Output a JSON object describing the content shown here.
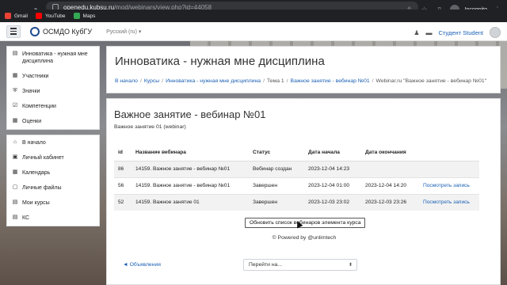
{
  "browser": {
    "url_host": "openedu.kubsu.ru",
    "url_path": "/mod/webinars/view.php?id=44058",
    "incognito_label": "Incognito",
    "bookmarks": [
      {
        "label": "Gmail",
        "color": "#ea4335"
      },
      {
        "label": "YouTube",
        "color": "#ff0000"
      },
      {
        "label": "Maps",
        "color": "#34a853"
      }
    ]
  },
  "navbar": {
    "brand": "ОСМДО КубГУ",
    "language": "Русский (ru) ▾",
    "user_name": "Студент Student"
  },
  "drawer": {
    "groups": [
      [
        {
          "label": "Инноватика - нужная мне дисциплина",
          "icon": "graduation-icon",
          "glyph": "▤"
        },
        {
          "label": "Участники",
          "icon": "users-icon",
          "glyph": "👥"
        },
        {
          "label": "Значки",
          "icon": "shield-icon",
          "glyph": "⛨"
        },
        {
          "label": "Компетенции",
          "icon": "checkbox-icon",
          "glyph": "☑"
        },
        {
          "label": "Оценки",
          "icon": "table-icon",
          "glyph": "▦"
        }
      ],
      [
        {
          "label": "В начало",
          "icon": "home-icon",
          "glyph": "⌂"
        },
        {
          "label": "Личный кабинет",
          "icon": "dashboard-icon",
          "glyph": "▣"
        },
        {
          "label": "Календарь",
          "icon": "calendar-icon",
          "glyph": "▦"
        },
        {
          "label": "Личные файлы",
          "icon": "file-icon",
          "glyph": "▢"
        },
        {
          "label": "Мои курсы",
          "icon": "graduation-icon",
          "glyph": "▤"
        },
        {
          "label": "КС",
          "icon": "graduation-icon",
          "glyph": "▤"
        }
      ]
    ]
  },
  "header": {
    "course_title": "Инноватика - нужная мне дисциплина",
    "breadcrumb": [
      "В начало",
      "Курсы",
      "Инноватика - нужная мне дисциплина",
      "Тема 1",
      "Важное занятие - вебинар №01",
      "Webinar.ru \"Важное занятие - вебинар №01\""
    ]
  },
  "main": {
    "title": "Важное занятие - вебинар №01",
    "subtitle": "Важное занятие 01 (webinar)",
    "columns": [
      "id",
      "Название вебинара",
      "Статус",
      "Дата начала",
      "Дата окончания",
      ""
    ],
    "rows": [
      {
        "id": "86",
        "name": "14159. Важное занятие - вебинар №01",
        "status": "Вебинар создан",
        "start": "2023-12-04 14:23",
        "end": "",
        "link": ""
      },
      {
        "id": "56",
        "name": "14159. Важное занятие - вебинар №01",
        "status": "Завершен",
        "start": "2023-12-04 01:00",
        "end": "2023-12-04 14:20",
        "link": "Посмотреть запись"
      },
      {
        "id": "52",
        "name": "14159. Важное занятие 01",
        "status": "Завершен",
        "start": "2023-12-03 23:02",
        "end": "2023-12-03 23:26",
        "link": "Посмотреть запись"
      }
    ],
    "update_button": "Обновить список вебинаров элемента курса",
    "powered_by": "© Powered by @unlimtech",
    "back_link": "◄ Объявления",
    "jump_placeholder": "Перейти на..."
  }
}
